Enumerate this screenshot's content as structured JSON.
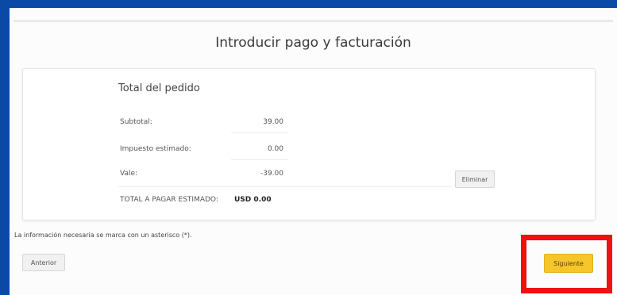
{
  "page": {
    "title": "Introducir pago y facturación"
  },
  "order": {
    "heading": "Total del pedido",
    "rows": [
      {
        "label": "Subtotal:",
        "value": "39.00"
      },
      {
        "label": "Impuesto estimado:",
        "value": "0.00"
      },
      {
        "label": "Vale:",
        "value": "-39.00"
      }
    ],
    "total_label": "TOTAL A PAGAR ESTIMADO:",
    "total_value": "USD 0.00",
    "remove_label": "Eliminar"
  },
  "footer": {
    "required_note": "La información necesaria se marca con un asterisco (*).",
    "back_label": "Anterior",
    "next_label": "Siguiente"
  },
  "colors": {
    "frame": "#0a4aa6",
    "next_button": "#f5c52a",
    "highlight": "#ee1111"
  }
}
